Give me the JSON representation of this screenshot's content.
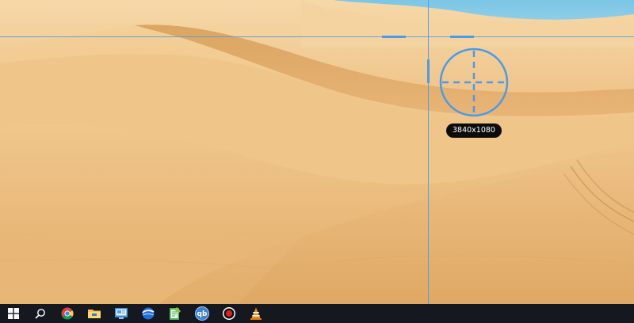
{
  "capture_overlay": {
    "resolution_label": "3840x1080",
    "accent_color": "#4a9be8"
  },
  "wallpaper": {
    "description_icon": "desert-dunes-wallpaper"
  },
  "taskbar": {
    "background": "#15191f",
    "items": [
      {
        "name": "start-button",
        "icon": "windows-logo-icon"
      },
      {
        "name": "search-button",
        "icon": "search-icon"
      },
      {
        "name": "chrome-button",
        "icon": "chrome-icon"
      },
      {
        "name": "file-explorer-button",
        "icon": "folder-icon"
      },
      {
        "name": "control-panel-button",
        "icon": "control-panel-icon"
      },
      {
        "name": "app-globe-button",
        "icon": "globe-app-icon"
      },
      {
        "name": "notepad-button",
        "icon": "notepad-icon"
      },
      {
        "name": "qbittorrent-button",
        "icon": "qbittorrent-icon",
        "text": "qb"
      },
      {
        "name": "recorder-button",
        "icon": "record-icon"
      },
      {
        "name": "vlc-button",
        "icon": "vlc-cone-icon"
      }
    ]
  }
}
